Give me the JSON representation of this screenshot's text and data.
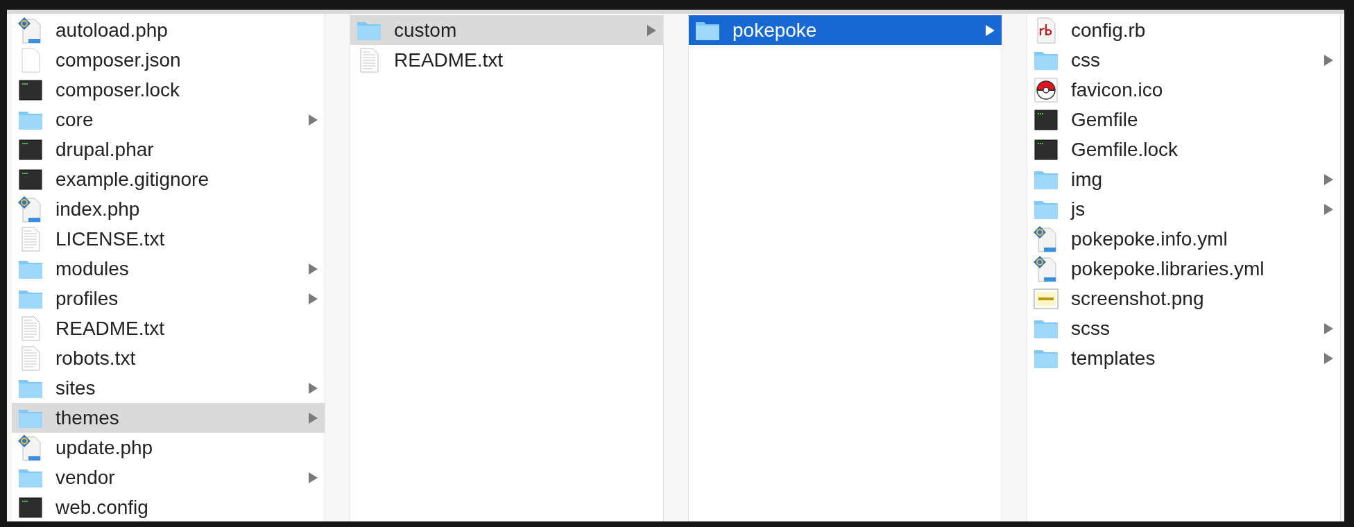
{
  "columns": [
    {
      "active": false,
      "items": [
        {
          "name": "autoload.php",
          "kind": "php",
          "selected": false
        },
        {
          "name": "composer.json",
          "kind": "file",
          "selected": false
        },
        {
          "name": "composer.lock",
          "kind": "terminal",
          "selected": false
        },
        {
          "name": "core",
          "kind": "folder",
          "selected": false
        },
        {
          "name": "drupal.phar",
          "kind": "terminal",
          "selected": false
        },
        {
          "name": "example.gitignore",
          "kind": "terminal",
          "selected": false
        },
        {
          "name": "index.php",
          "kind": "php",
          "selected": false
        },
        {
          "name": "LICENSE.txt",
          "kind": "text",
          "selected": false
        },
        {
          "name": "modules",
          "kind": "folder",
          "selected": false
        },
        {
          "name": "profiles",
          "kind": "folder",
          "selected": false
        },
        {
          "name": "README.txt",
          "kind": "text",
          "selected": false
        },
        {
          "name": "robots.txt",
          "kind": "text",
          "selected": false
        },
        {
          "name": "sites",
          "kind": "folder",
          "selected": false
        },
        {
          "name": "themes",
          "kind": "folder",
          "selected": true
        },
        {
          "name": "update.php",
          "kind": "php",
          "selected": false
        },
        {
          "name": "vendor",
          "kind": "folder",
          "selected": false
        },
        {
          "name": "web.config",
          "kind": "terminal",
          "selected": false
        }
      ]
    },
    {
      "active": false,
      "items": [
        {
          "name": "custom",
          "kind": "folder",
          "selected": true
        },
        {
          "name": "README.txt",
          "kind": "text",
          "selected": false
        }
      ]
    },
    {
      "active": true,
      "items": [
        {
          "name": "pokepoke",
          "kind": "folder",
          "selected": true
        }
      ]
    },
    {
      "active": false,
      "items": [
        {
          "name": "config.rb",
          "kind": "ruby",
          "selected": false
        },
        {
          "name": "css",
          "kind": "folder",
          "selected": false
        },
        {
          "name": "favicon.ico",
          "kind": "ball",
          "selected": false
        },
        {
          "name": "Gemfile",
          "kind": "terminal",
          "selected": false
        },
        {
          "name": "Gemfile.lock",
          "kind": "terminal",
          "selected": false
        },
        {
          "name": "img",
          "kind": "folder",
          "selected": false
        },
        {
          "name": "js",
          "kind": "folder",
          "selected": false
        },
        {
          "name": "pokepoke.info.yml",
          "kind": "php",
          "selected": false
        },
        {
          "name": "pokepoke.libraries.yml",
          "kind": "php",
          "selected": false
        },
        {
          "name": "screenshot.png",
          "kind": "image",
          "selected": false
        },
        {
          "name": "scss",
          "kind": "folder",
          "selected": false
        },
        {
          "name": "templates",
          "kind": "folder",
          "selected": false
        }
      ]
    }
  ]
}
